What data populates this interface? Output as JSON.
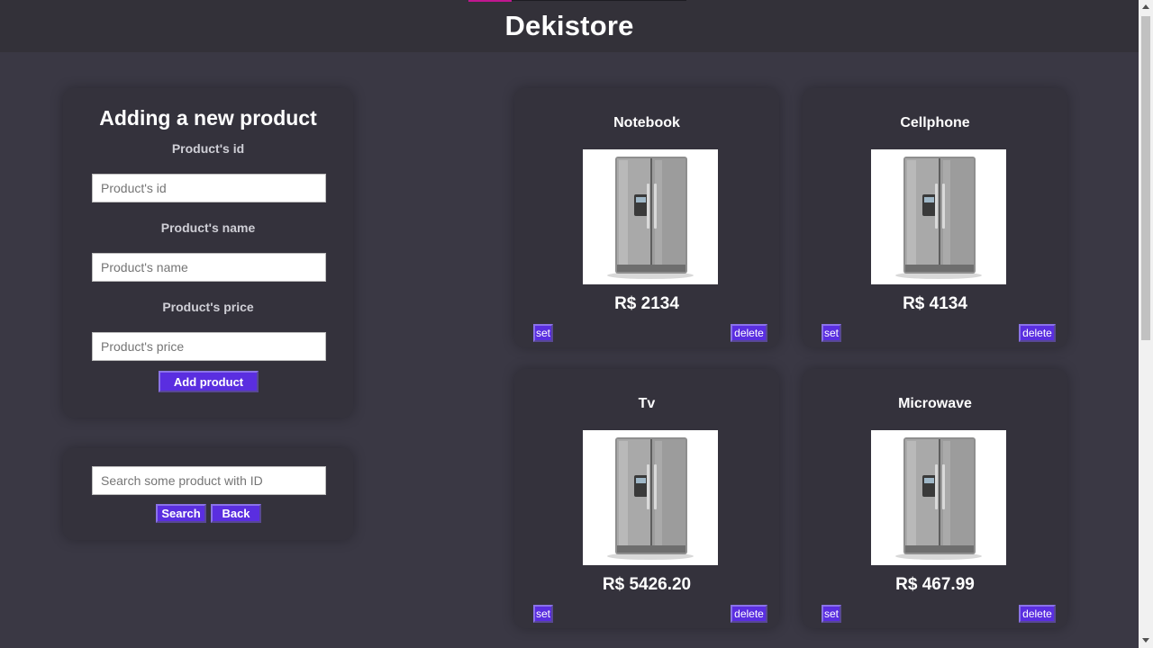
{
  "header": {
    "title": "Dekistore"
  },
  "form": {
    "title": "Adding a new product",
    "id_label": "Product's id",
    "id_placeholder": "Product's id",
    "name_label": "Product's name",
    "name_placeholder": "Product's name",
    "price_label": "Product's price",
    "price_placeholder": "Product's price",
    "submit_label": "Add product"
  },
  "search": {
    "placeholder": "Search some product with ID",
    "search_label": "Search",
    "back_label": "Back"
  },
  "products": [
    {
      "name": "Notebook",
      "price": "R$ 2134",
      "set_label": "set",
      "delete_label": "delete",
      "image": "refrigerator-image"
    },
    {
      "name": "Cellphone",
      "price": "R$ 4134",
      "set_label": "set",
      "delete_label": "delete",
      "image": "refrigerator-image"
    },
    {
      "name": "Tv",
      "price": "R$ 5426.20",
      "set_label": "set",
      "delete_label": "delete",
      "image": "refrigerator-image"
    },
    {
      "name": "Microwave",
      "price": "R$ 467.99",
      "set_label": "set",
      "delete_label": "delete",
      "image": "refrigerator-image"
    }
  ],
  "colors": {
    "background": "#3a3844",
    "header": "#333139",
    "panel": "#34323c",
    "button": "#5a2ee0",
    "accent": "#c0178f"
  }
}
